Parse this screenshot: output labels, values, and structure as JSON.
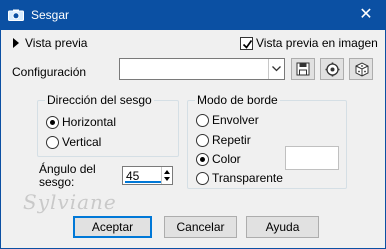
{
  "window": {
    "title": "Sesgar",
    "close_glyph": "✕"
  },
  "preview": {
    "toggle_label": "Vista previa",
    "image_checkbox_label": "Vista previa en imagen",
    "image_checkbox_checked": true
  },
  "config": {
    "label": "Configuración",
    "select_value": "",
    "buttons": [
      "save-icon",
      "settings-icon",
      "dice-icon"
    ]
  },
  "direction_group": {
    "title": "Dirección del sesgo",
    "options": [
      "Horizontal",
      "Vertical"
    ],
    "selected": "Horizontal"
  },
  "border_group": {
    "title": "Modo de borde",
    "options": [
      "Envolver",
      "Repetir",
      "Color",
      "Transparente"
    ],
    "selected": "Color",
    "color_value": "#ffffff"
  },
  "angle": {
    "label_line1": "Ángulo del",
    "label_line2": "sesgo:",
    "value": "45"
  },
  "watermark": "Sylviane",
  "footer": {
    "accept": "Aceptar",
    "cancel": "Cancelar",
    "help": "Ayuda"
  },
  "colors": {
    "titlebar": "#0b50a3",
    "client": "#f0f0f0",
    "accent": "#0078d7"
  }
}
